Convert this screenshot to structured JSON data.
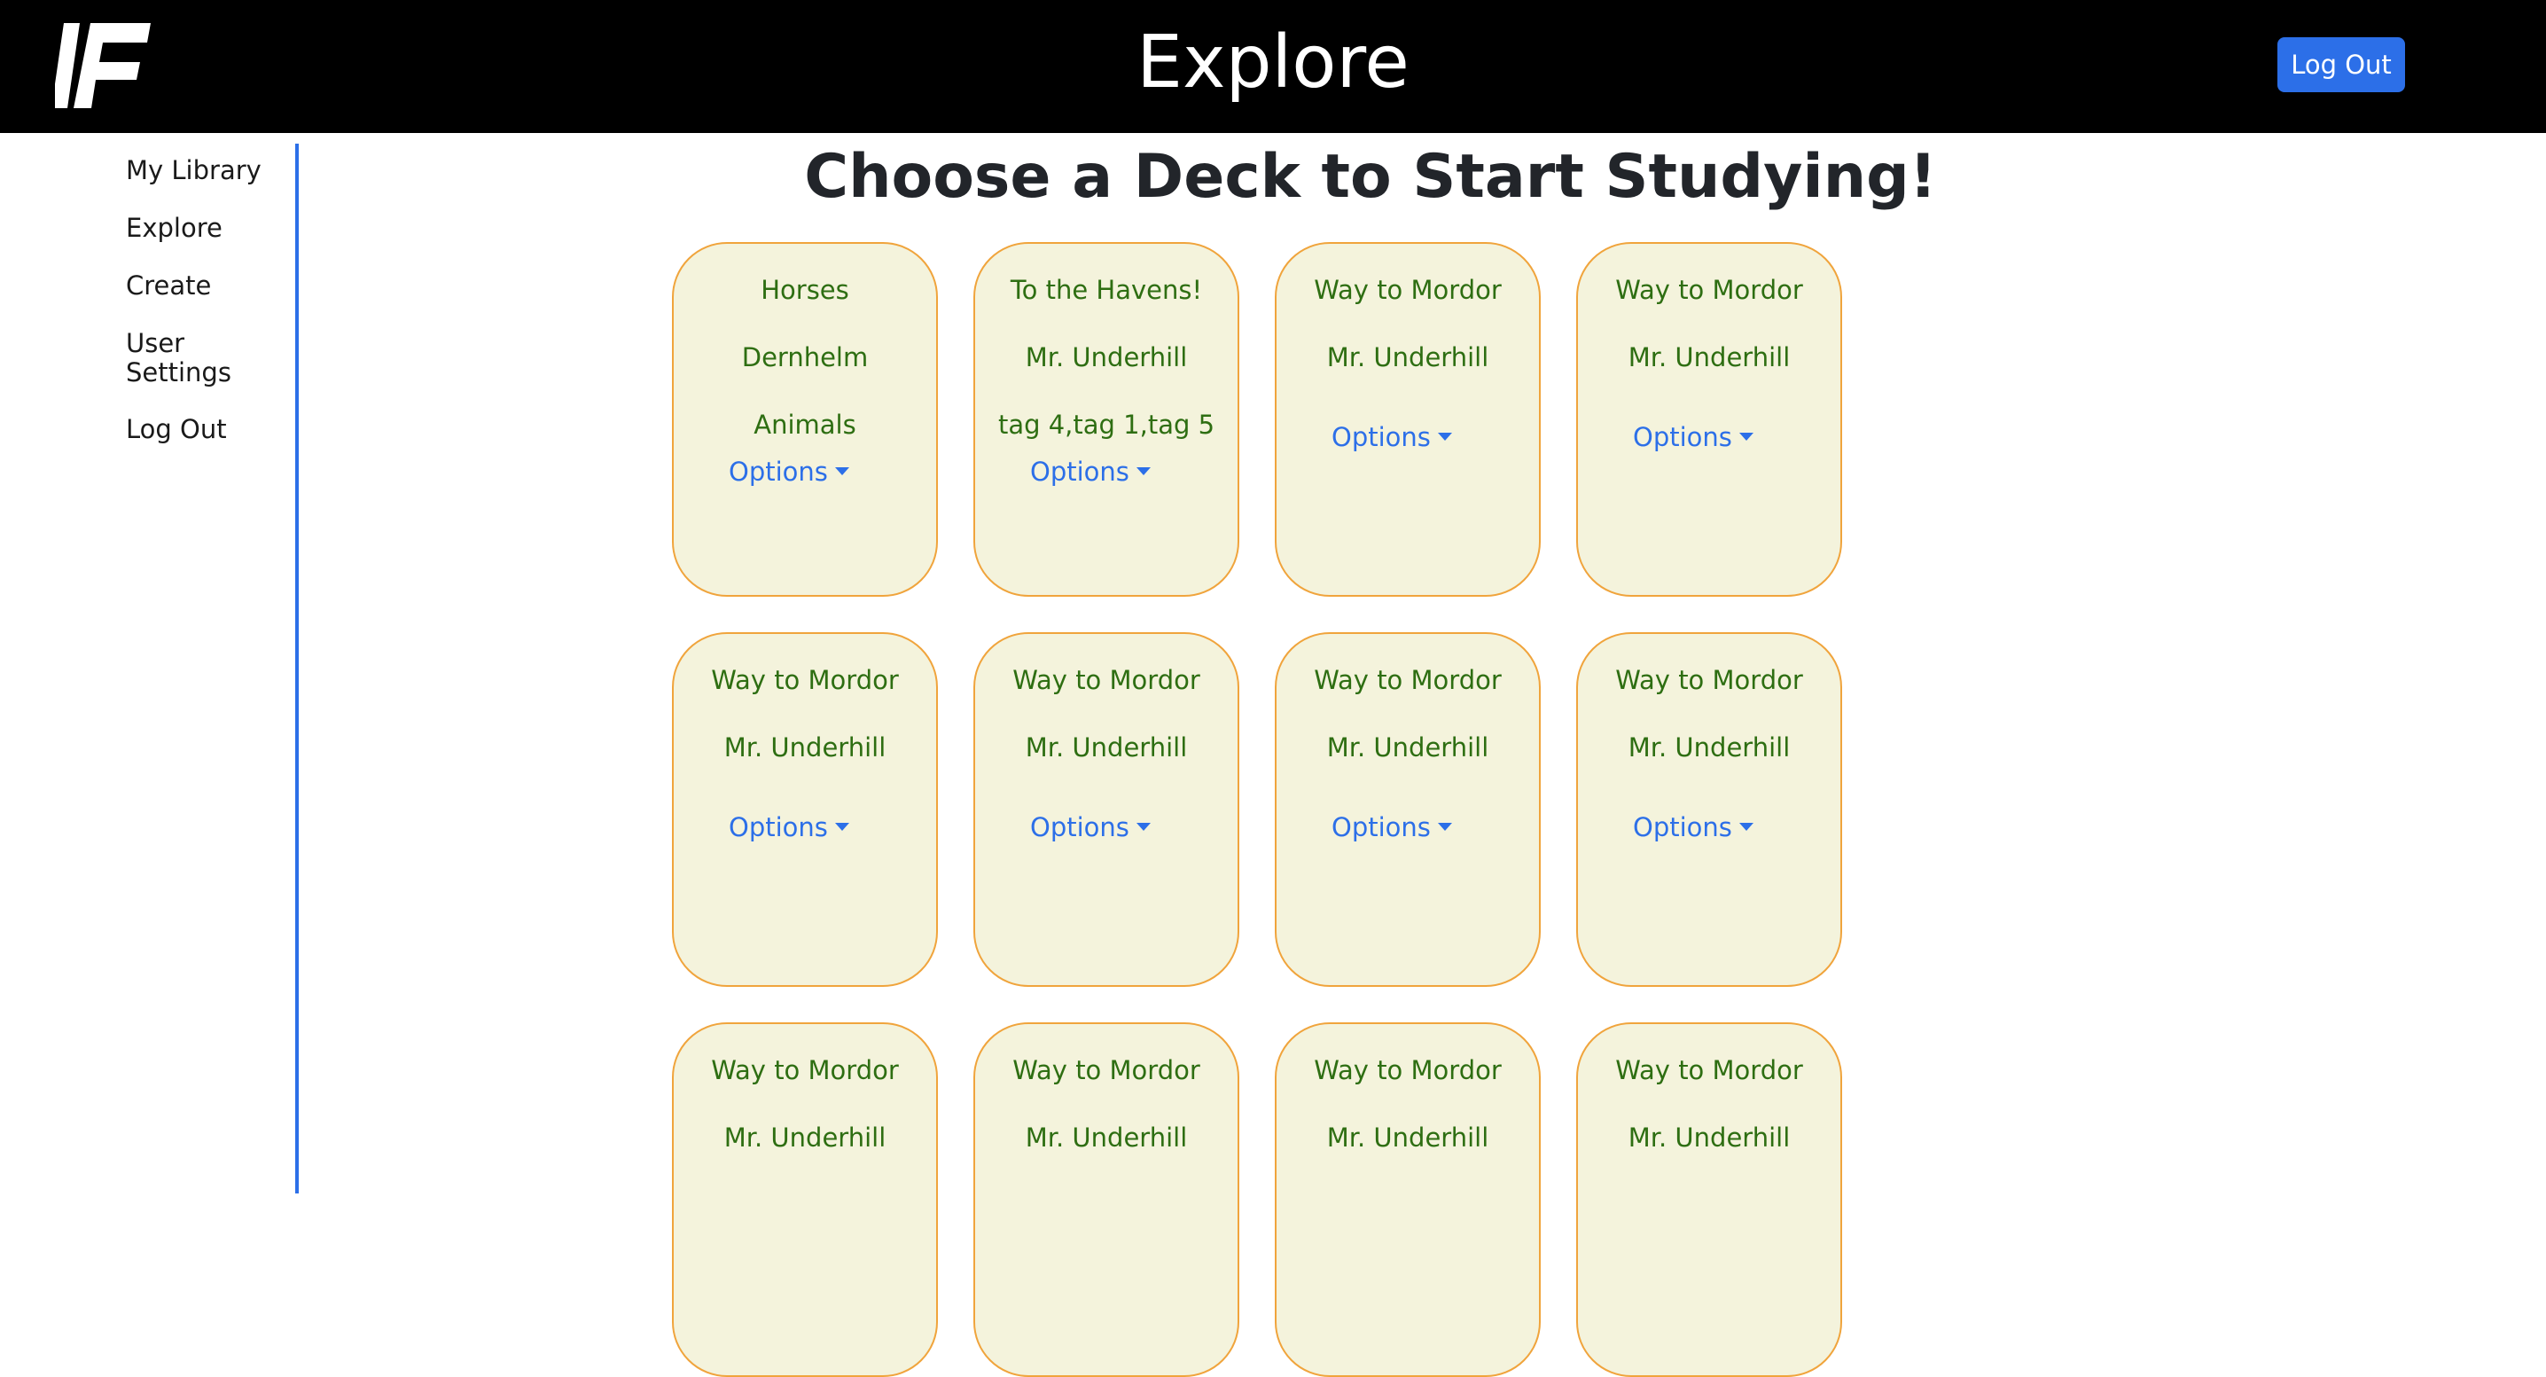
{
  "header": {
    "logo_icon": "ff-logo-icon",
    "title": "Explore",
    "logout_label": "Log Out"
  },
  "sidebar": {
    "items": [
      {
        "label": "My Library"
      },
      {
        "label": "Explore"
      },
      {
        "label": "Create"
      },
      {
        "label": "User Settings"
      },
      {
        "label": "Log Out"
      }
    ]
  },
  "main": {
    "title": "Choose a Deck to Start Studying!",
    "options_label": "Options",
    "decks": [
      {
        "title": "Horses",
        "author": "Dernhelm",
        "tags": "Animals"
      },
      {
        "title": "To the Havens!",
        "author": "Mr. Underhill",
        "tags": "tag 4,tag 1,tag 5"
      },
      {
        "title": "Way to Mordor",
        "author": "Mr. Underhill",
        "tags": ""
      },
      {
        "title": "Way to Mordor",
        "author": "Mr. Underhill",
        "tags": ""
      },
      {
        "title": "Way to Mordor",
        "author": "Mr. Underhill",
        "tags": ""
      },
      {
        "title": "Way to Mordor",
        "author": "Mr. Underhill",
        "tags": ""
      },
      {
        "title": "Way to Mordor",
        "author": "Mr. Underhill",
        "tags": ""
      },
      {
        "title": "Way to Mordor",
        "author": "Mr. Underhill",
        "tags": ""
      },
      {
        "title": "Way to Mordor",
        "author": "Mr. Underhill",
        "tags": ""
      },
      {
        "title": "Way to Mordor",
        "author": "Mr. Underhill",
        "tags": ""
      },
      {
        "title": "Way to Mordor",
        "author": "Mr. Underhill",
        "tags": ""
      },
      {
        "title": "Way to Mordor",
        "author": "Mr. Underhill",
        "tags": ""
      }
    ]
  },
  "colors": {
    "header_bg": "#000000",
    "accent": "#2c6fe8",
    "card_bg": "#f4f3dc",
    "card_border": "#f0a43c",
    "card_text": "#2e6e12"
  }
}
